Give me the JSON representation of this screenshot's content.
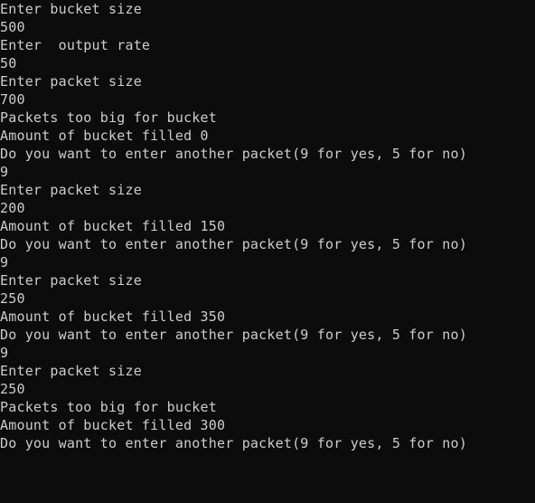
{
  "console": {
    "lines": [
      "Enter bucket size",
      "500",
      "Enter  output rate",
      "50",
      "Enter packet size",
      "700",
      "Packets too big for bucket",
      "Amount of bucket filled 0",
      "Do you want to enter another packet(9 for yes, 5 for no)",
      "9",
      "Enter packet size",
      "200",
      "Amount of bucket filled 150",
      "Do you want to enter another packet(9 for yes, 5 for no)",
      "9",
      "Enter packet size",
      "250",
      "Amount of bucket filled 350",
      "Do you want to enter another packet(9 for yes, 5 for no)",
      "9",
      "Enter packet size",
      "250",
      "Packets too big for bucket",
      "Amount of bucket filled 300",
      "Do you want to enter another packet(9 for yes, 5 for no)"
    ]
  },
  "colors": {
    "background": "#0c0c0c",
    "text": "#cccccc"
  }
}
